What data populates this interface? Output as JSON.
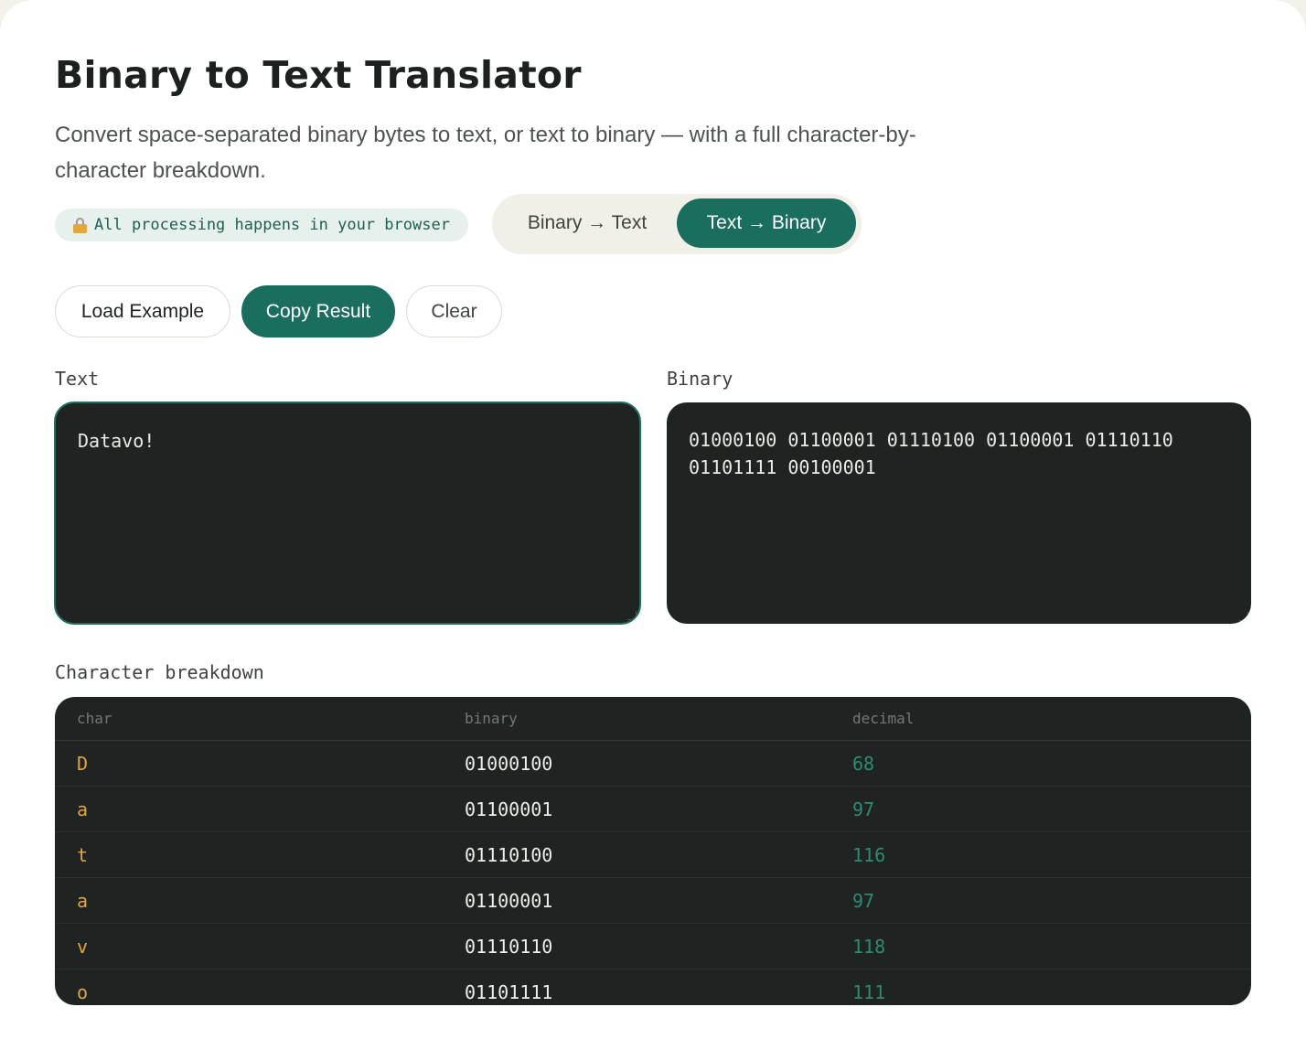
{
  "header": {
    "title": "Binary to Text Translator",
    "subtitle": "Convert space-separated binary bytes to text, or text to binary — with a full character-by-character breakdown."
  },
  "privacy_badge": {
    "icon": "lock-icon",
    "text": "All processing happens in your browser"
  },
  "mode_toggle": {
    "options": [
      "Binary → Text",
      "Text → Binary"
    ],
    "selected": "Text → Binary"
  },
  "actions": {
    "load_example": "Load Example",
    "copy_result": "Copy Result",
    "clear": "Clear"
  },
  "input": {
    "label": "Text",
    "value": "Datavo!"
  },
  "output": {
    "label": "Binary",
    "value": "01000100 01100001 01110100 01100001 01110110 01101111 00100001"
  },
  "breakdown": {
    "label": "Character breakdown",
    "columns": [
      "char",
      "binary",
      "decimal"
    ],
    "rows": [
      [
        "D",
        "01000100",
        "68"
      ],
      [
        "a",
        "01100001",
        "97"
      ],
      [
        "t",
        "01110100",
        "116"
      ],
      [
        "a",
        "01100001",
        "97"
      ],
      [
        "v",
        "01110110",
        "118"
      ],
      [
        "o",
        "01101111",
        "111"
      ]
    ]
  },
  "colors": {
    "accent": "#1a6e5d",
    "panel_bg": "#1f2321",
    "char_color": "#e3a43c",
    "decimal_color": "#2f8a74"
  }
}
